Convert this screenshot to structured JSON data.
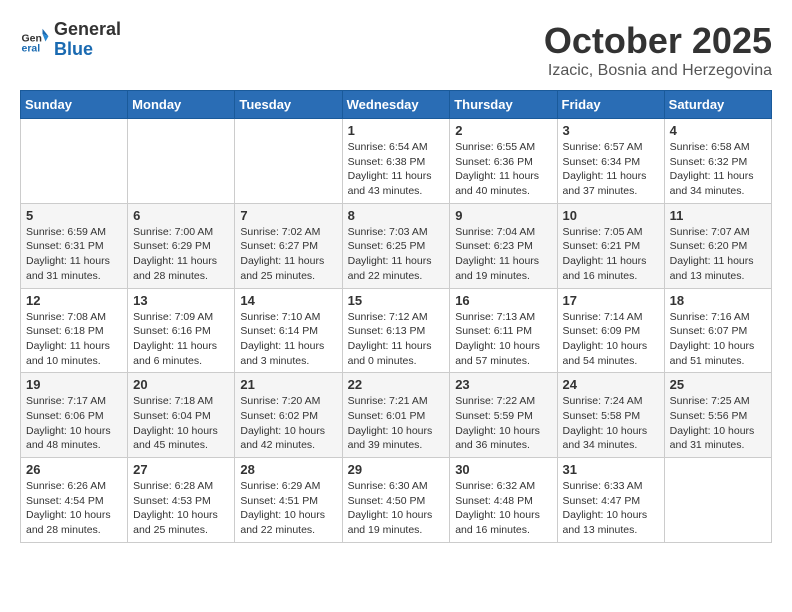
{
  "header": {
    "logo_general": "General",
    "logo_blue": "Blue",
    "month": "October 2025",
    "location": "Izacic, Bosnia and Herzegovina"
  },
  "weekdays": [
    "Sunday",
    "Monday",
    "Tuesday",
    "Wednesday",
    "Thursday",
    "Friday",
    "Saturday"
  ],
  "weeks": [
    [
      {
        "day": "",
        "info": ""
      },
      {
        "day": "",
        "info": ""
      },
      {
        "day": "",
        "info": ""
      },
      {
        "day": "1",
        "info": "Sunrise: 6:54 AM\nSunset: 6:38 PM\nDaylight: 11 hours\nand 43 minutes."
      },
      {
        "day": "2",
        "info": "Sunrise: 6:55 AM\nSunset: 6:36 PM\nDaylight: 11 hours\nand 40 minutes."
      },
      {
        "day": "3",
        "info": "Sunrise: 6:57 AM\nSunset: 6:34 PM\nDaylight: 11 hours\nand 37 minutes."
      },
      {
        "day": "4",
        "info": "Sunrise: 6:58 AM\nSunset: 6:32 PM\nDaylight: 11 hours\nand 34 minutes."
      }
    ],
    [
      {
        "day": "5",
        "info": "Sunrise: 6:59 AM\nSunset: 6:31 PM\nDaylight: 11 hours\nand 31 minutes."
      },
      {
        "day": "6",
        "info": "Sunrise: 7:00 AM\nSunset: 6:29 PM\nDaylight: 11 hours\nand 28 minutes."
      },
      {
        "day": "7",
        "info": "Sunrise: 7:02 AM\nSunset: 6:27 PM\nDaylight: 11 hours\nand 25 minutes."
      },
      {
        "day": "8",
        "info": "Sunrise: 7:03 AM\nSunset: 6:25 PM\nDaylight: 11 hours\nand 22 minutes."
      },
      {
        "day": "9",
        "info": "Sunrise: 7:04 AM\nSunset: 6:23 PM\nDaylight: 11 hours\nand 19 minutes."
      },
      {
        "day": "10",
        "info": "Sunrise: 7:05 AM\nSunset: 6:21 PM\nDaylight: 11 hours\nand 16 minutes."
      },
      {
        "day": "11",
        "info": "Sunrise: 7:07 AM\nSunset: 6:20 PM\nDaylight: 11 hours\nand 13 minutes."
      }
    ],
    [
      {
        "day": "12",
        "info": "Sunrise: 7:08 AM\nSunset: 6:18 PM\nDaylight: 11 hours\nand 10 minutes."
      },
      {
        "day": "13",
        "info": "Sunrise: 7:09 AM\nSunset: 6:16 PM\nDaylight: 11 hours\nand 6 minutes."
      },
      {
        "day": "14",
        "info": "Sunrise: 7:10 AM\nSunset: 6:14 PM\nDaylight: 11 hours\nand 3 minutes."
      },
      {
        "day": "15",
        "info": "Sunrise: 7:12 AM\nSunset: 6:13 PM\nDaylight: 11 hours\nand 0 minutes."
      },
      {
        "day": "16",
        "info": "Sunrise: 7:13 AM\nSunset: 6:11 PM\nDaylight: 10 hours\nand 57 minutes."
      },
      {
        "day": "17",
        "info": "Sunrise: 7:14 AM\nSunset: 6:09 PM\nDaylight: 10 hours\nand 54 minutes."
      },
      {
        "day": "18",
        "info": "Sunrise: 7:16 AM\nSunset: 6:07 PM\nDaylight: 10 hours\nand 51 minutes."
      }
    ],
    [
      {
        "day": "19",
        "info": "Sunrise: 7:17 AM\nSunset: 6:06 PM\nDaylight: 10 hours\nand 48 minutes."
      },
      {
        "day": "20",
        "info": "Sunrise: 7:18 AM\nSunset: 6:04 PM\nDaylight: 10 hours\nand 45 minutes."
      },
      {
        "day": "21",
        "info": "Sunrise: 7:20 AM\nSunset: 6:02 PM\nDaylight: 10 hours\nand 42 minutes."
      },
      {
        "day": "22",
        "info": "Sunrise: 7:21 AM\nSunset: 6:01 PM\nDaylight: 10 hours\nand 39 minutes."
      },
      {
        "day": "23",
        "info": "Sunrise: 7:22 AM\nSunset: 5:59 PM\nDaylight: 10 hours\nand 36 minutes."
      },
      {
        "day": "24",
        "info": "Sunrise: 7:24 AM\nSunset: 5:58 PM\nDaylight: 10 hours\nand 34 minutes."
      },
      {
        "day": "25",
        "info": "Sunrise: 7:25 AM\nSunset: 5:56 PM\nDaylight: 10 hours\nand 31 minutes."
      }
    ],
    [
      {
        "day": "26",
        "info": "Sunrise: 6:26 AM\nSunset: 4:54 PM\nDaylight: 10 hours\nand 28 minutes."
      },
      {
        "day": "27",
        "info": "Sunrise: 6:28 AM\nSunset: 4:53 PM\nDaylight: 10 hours\nand 25 minutes."
      },
      {
        "day": "28",
        "info": "Sunrise: 6:29 AM\nSunset: 4:51 PM\nDaylight: 10 hours\nand 22 minutes."
      },
      {
        "day": "29",
        "info": "Sunrise: 6:30 AM\nSunset: 4:50 PM\nDaylight: 10 hours\nand 19 minutes."
      },
      {
        "day": "30",
        "info": "Sunrise: 6:32 AM\nSunset: 4:48 PM\nDaylight: 10 hours\nand 16 minutes."
      },
      {
        "day": "31",
        "info": "Sunrise: 6:33 AM\nSunset: 4:47 PM\nDaylight: 10 hours\nand 13 minutes."
      },
      {
        "day": "",
        "info": ""
      }
    ]
  ]
}
